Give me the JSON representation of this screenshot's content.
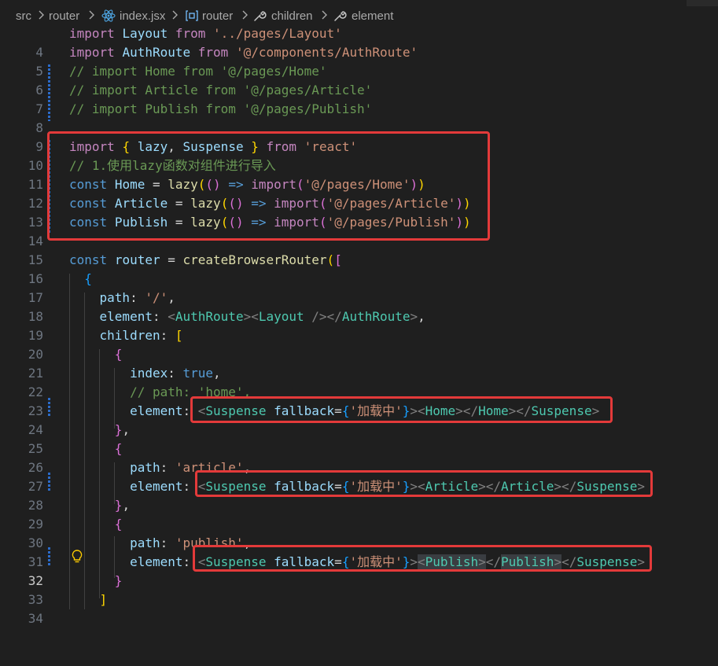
{
  "breadcrumb": {
    "src": "src",
    "router": "router",
    "file": "index.jsx",
    "symbol_router": "router",
    "children": "children",
    "element": "element"
  },
  "lines": [
    {
      "n": "4",
      "code": "import Layout from '../pages/Layout'"
    },
    {
      "n": "5",
      "code": "import AuthRoute from '@/components/AuthRoute'"
    },
    {
      "n": "6",
      "code": "// import Home from '@/pages/Home'"
    },
    {
      "n": "7",
      "code": "// import Article from '@/pages/Article'"
    },
    {
      "n": "8",
      "code": "// import Publish from '@/pages/Publish'"
    },
    {
      "n": "9",
      "code": ""
    },
    {
      "n": "10",
      "code": "import { lazy, Suspense } from 'react'"
    },
    {
      "n": "11",
      "code": "// 1.使用lazy函数对组件进行导入"
    },
    {
      "n": "12",
      "code": "const Home = lazy(() => import('@/pages/Home'))"
    },
    {
      "n": "13",
      "code": "const Article = lazy(() => import('@/pages/Article'))"
    },
    {
      "n": "14",
      "code": "const Publish = lazy(() => import('@/pages/Publish'))"
    },
    {
      "n": "15",
      "code": ""
    },
    {
      "n": "16",
      "code": "const router = createBrowserRouter(["
    },
    {
      "n": "17",
      "code": "  {"
    },
    {
      "n": "18",
      "code": "    path: '/',"
    },
    {
      "n": "19",
      "code": "    element: <AuthRoute><Layout /></AuthRoute>,"
    },
    {
      "n": "20",
      "code": "    children: ["
    },
    {
      "n": "21",
      "code": "      {"
    },
    {
      "n": "22",
      "code": "        index: true,"
    },
    {
      "n": "23",
      "code": "        // path: 'home',"
    },
    {
      "n": "24",
      "code": "        element: <Suspense fallback={'加载中'}><Home></Home></Suspense>"
    },
    {
      "n": "25",
      "code": "      },"
    },
    {
      "n": "26",
      "code": "      {"
    },
    {
      "n": "27",
      "code": "        path: 'article',"
    },
    {
      "n": "28",
      "code": "        element: <Suspense fallback={'加载中'}><Article></Article></Suspense>"
    },
    {
      "n": "29",
      "code": "      },"
    },
    {
      "n": "30",
      "code": "      {"
    },
    {
      "n": "31",
      "code": "        path: 'publish',"
    },
    {
      "n": "32",
      "code": "        element: <Suspense fallback={'加载中'}><Publish></Publish></Suspense>"
    },
    {
      "n": "33",
      "code": "      }"
    },
    {
      "n": "34",
      "code": "    ]"
    }
  ],
  "active_line": "32",
  "colors": {
    "background": "#1f1f1f",
    "annotation_red": "#e33a3a",
    "keyword": "#569cd6",
    "control_keyword": "#c586c0",
    "string": "#ce9178",
    "comment": "#6a9955",
    "variable": "#9cdcfe",
    "component": "#4ec9b0",
    "function": "#dcdcaa"
  },
  "icons": [
    "react-component-icon",
    "symbol-variable-icon",
    "wrench-icon",
    "lightbulb-icon",
    "chevron-right-icon"
  ]
}
